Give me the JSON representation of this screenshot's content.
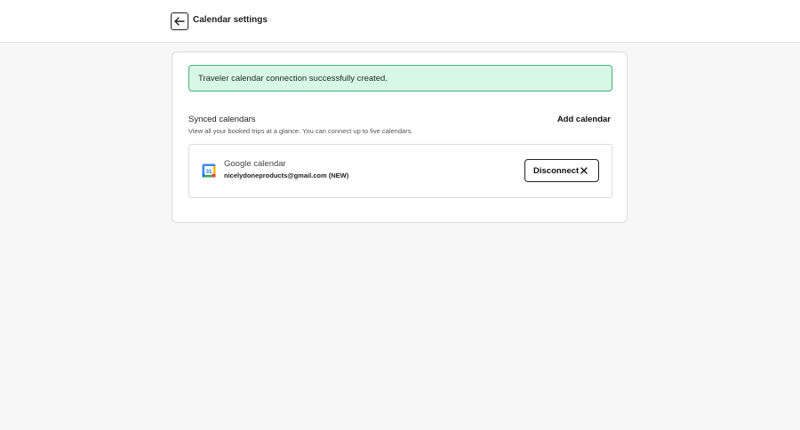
{
  "header": {
    "title": "Calendar settings",
    "back_icon": "arrow-left-icon"
  },
  "banner": {
    "message": "Traveler calendar connection successfully created.",
    "status_color": "#45b27c"
  },
  "synced": {
    "title": "Synced calendars",
    "description": "View all your booked trips at a glance. You can connect up to five calendars.",
    "add_label": "Add calendar"
  },
  "calendar": {
    "icon": "google-calendar-icon",
    "name": "Google calendar",
    "email": "nicelydoneproducts@gmail.com (NEW)",
    "icon_day": "31",
    "disconnect_label": "Disconnect",
    "disconnect_icon": "close-icon"
  }
}
